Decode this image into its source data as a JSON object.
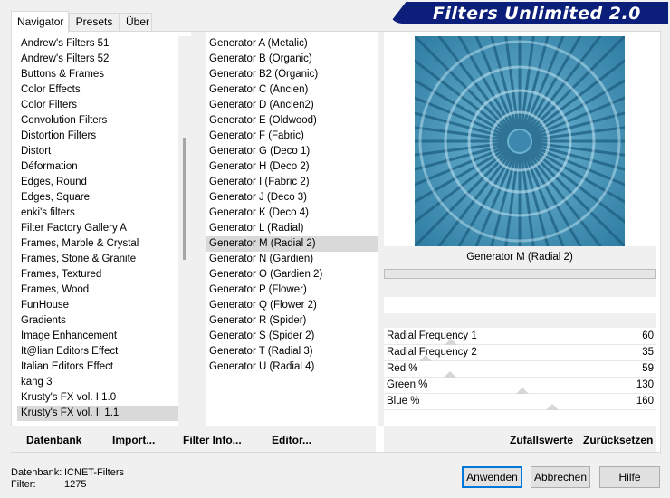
{
  "tabs": [
    "Navigator",
    "Presets",
    "Über"
  ],
  "app_title": "Filters Unlimited 2.0",
  "categories": [
    "Andrew's Filters 51",
    "Andrew's Filters 52",
    "Buttons & Frames",
    "Color Effects",
    "Color Filters",
    "Convolution Filters",
    "Distortion Filters",
    "Distort",
    "Déformation",
    "Edges, Round",
    "Edges, Square",
    "enki's filters",
    "Filter Factory Gallery A",
    "Frames, Marble & Crystal",
    "Frames, Stone & Granite",
    "Frames, Textured",
    "Frames, Wood",
    "FunHouse",
    "Gradients",
    "Image Enhancement",
    "It@lian Editors Effect",
    "Italian Editors Effect",
    "kang 3",
    "Krusty's FX vol. I 1.0",
    "Krusty's FX vol. II 1.1"
  ],
  "selected_category": "Krusty's FX vol. II 1.1",
  "filters": [
    "Generator A (Metalic)",
    "Generator B (Organic)",
    "Generator B2 (Organic)",
    "Generator C (Ancien)",
    "Generator D (Ancien2)",
    "Generator E (Oldwood)",
    "Generator F (Fabric)",
    "Generator G (Deco 1)",
    "Generator H (Deco 2)",
    "Generator I (Fabric 2)",
    "Generator J (Deco 3)",
    "Generator K (Deco 4)",
    "Generator L (Radial)",
    "Generator M (Radial 2)",
    "Generator N (Gardien)",
    "Generator O (Gardien 2)",
    "Generator P (Flower)",
    "Generator Q (Flower 2)",
    "Generator R (Spider)",
    "Generator S (Spider 2)",
    "Generator T (Radial 3)",
    "Generator U (Radial 4)"
  ],
  "selected_filter": "Generator M (Radial 2)",
  "preview": {
    "filter_name": "Generator M (Radial 2)"
  },
  "parameters": [
    {
      "label": "Radial Frequency 1",
      "value": "60",
      "level": 60
    },
    {
      "label": "Radial Frequency 2",
      "value": "35",
      "level": 35
    },
    {
      "label": "Red %",
      "value": "59",
      "level": 59
    },
    {
      "label": "Green %",
      "value": "130",
      "level": 130
    },
    {
      "label": "Blue %",
      "value": "160",
      "level": 160
    }
  ],
  "bottom_links": {
    "database": "Datenbank",
    "import": "Import...",
    "filter_info": "Filter Info...",
    "editor": "Editor...",
    "randomize": "Zufallswerte",
    "reset": "Zurücksetzen"
  },
  "status": {
    "database_label": "Datenbank:",
    "database_value": "ICNET-Filters",
    "filter_label": "Filter:",
    "filter_value": "1275"
  },
  "buttons": {
    "apply": "Anwenden",
    "cancel": "Abbrechen",
    "help": "Hilfe"
  },
  "colors": {
    "title_banner": "#0a1e7a",
    "preview_base": "#3d8bb0",
    "selection": "#d9d9d9"
  }
}
